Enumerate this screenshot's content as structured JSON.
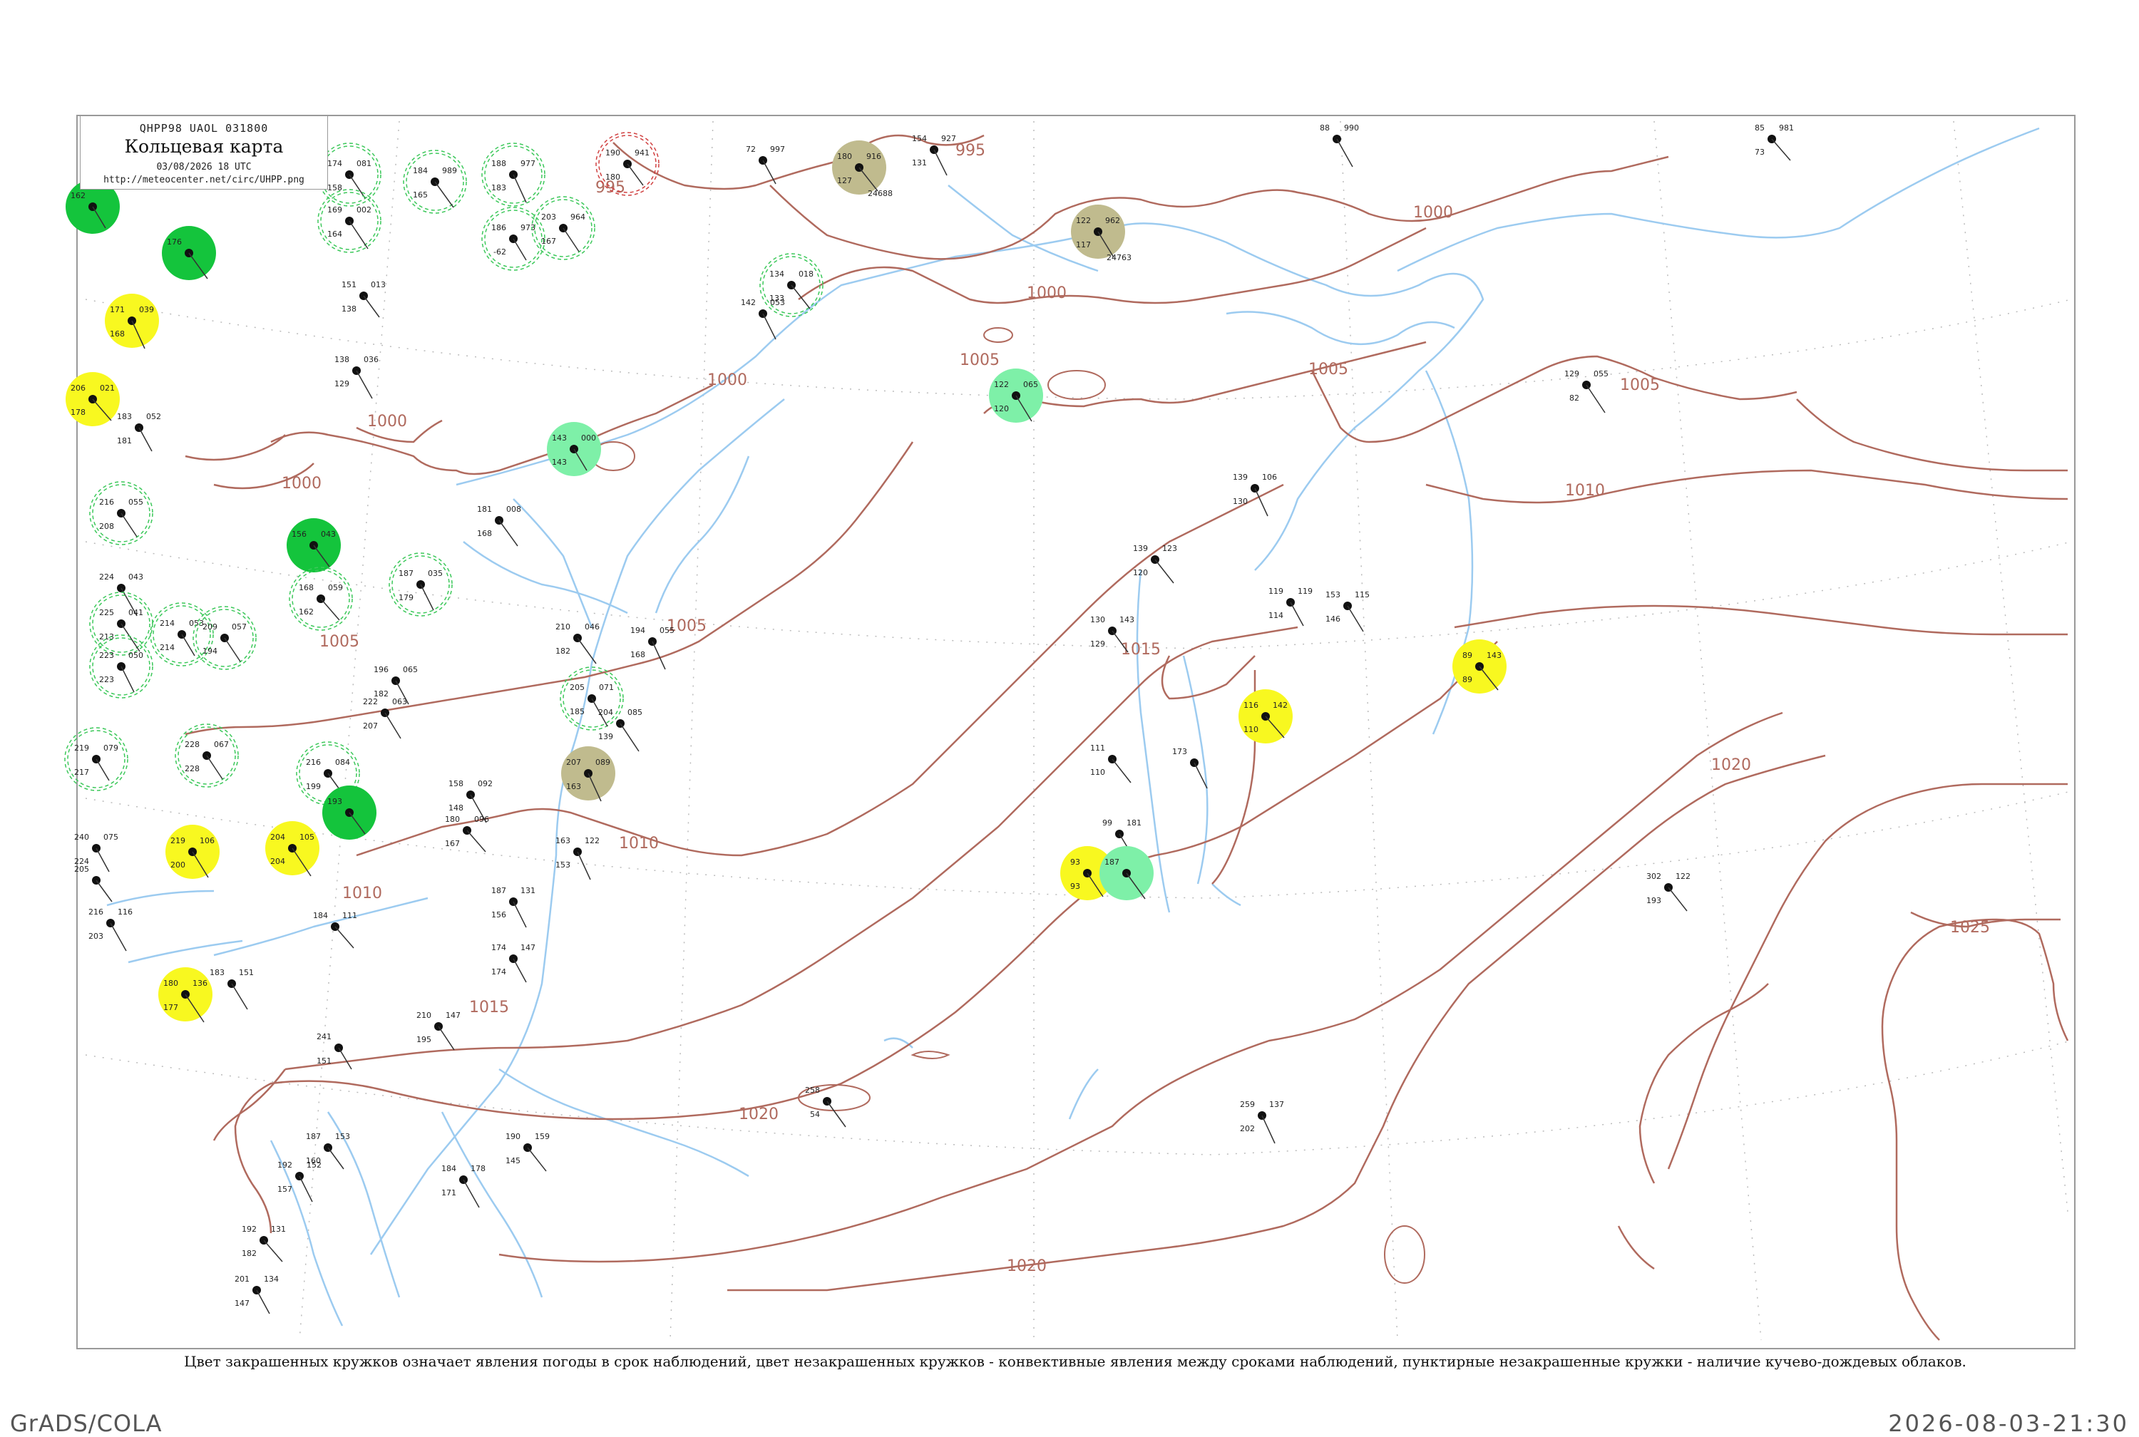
{
  "header": {
    "code": "QHPP98  UAOL  031800",
    "title": "Кольцевая карта",
    "date": "03/08/2026 18 UTC",
    "url": "http://meteocenter.net/circ/UHPP.png"
  },
  "caption": "Цвет закрашенных кружков означает явления погоды в срок наблюдений, цвет незакрашенных кружков - конвективные явления между сроками наблюдений, пунктирные незакрашенные кружки - наличие кучево-дождевых облаков.",
  "footer": {
    "left": "GrADS/COLA",
    "right": "2026-08-03-21:30"
  },
  "colors": {
    "isobar": "#b06a5e",
    "water": "#9ccbf0",
    "rain": "#14c43c",
    "drizzle": "#7ef0a8",
    "fog": "#f8f820",
    "haze": "#c0bb8e",
    "shower_outline": "#3cc85a"
  },
  "isobar_labels": [
    "995",
    "995",
    "1000",
    "1000",
    "1000",
    "1000",
    "1000",
    "1005",
    "1005",
    "1005",
    "1005",
    "1005",
    "1010",
    "1010",
    "1010",
    "1015",
    "1015",
    "1020",
    "1020",
    "1020",
    "1025"
  ],
  "stations": [
    {
      "name": "",
      "id": "",
      "t": "162",
      "p": "",
      "td": "",
      "wx": "rain"
    },
    {
      "name": "",
      "id": "",
      "t": "174",
      "p": "081",
      "td": "158",
      "wx": "shower"
    },
    {
      "name": "",
      "id": "",
      "t": "184",
      "p": "989",
      "td": "165",
      "wx": "shower"
    },
    {
      "name": "",
      "id": "",
      "t": "188",
      "p": "977",
      "td": "183",
      "wx": "shower"
    },
    {
      "name": "",
      "id": "",
      "t": "190",
      "p": "941",
      "td": "180",
      "wx": "thunder"
    },
    {
      "name": "",
      "id": "24688",
      "t": "180",
      "p": "916",
      "td": "127",
      "wx": "haze"
    },
    {
      "name": "",
      "id": "",
      "t": "154",
      "p": "927",
      "td": "131",
      "wx": "none"
    },
    {
      "name": "",
      "id": "",
      "t": "88",
      "p": "990",
      "td": "",
      "wx": "none"
    },
    {
      "name": "",
      "id": "",
      "t": "85",
      "p": "981",
      "td": "73",
      "wx": "none"
    },
    {
      "name": "",
      "id": "",
      "t": "72",
      "p": "997",
      "td": "",
      "wx": "none"
    },
    {
      "name": "",
      "id": "24763",
      "t": "122",
      "p": "962",
      "td": "117",
      "wx": "haze"
    },
    {
      "name": "",
      "id": "",
      "t": "169",
      "p": "002",
      "td": "164",
      "wx": "shower"
    },
    {
      "name": "",
      "id": "",
      "t": "186",
      "p": "973",
      "td": "-62",
      "wx": "shower"
    },
    {
      "name": "",
      "id": "",
      "t": "203",
      "p": "964",
      "td": "167",
      "wx": "shower"
    },
    {
      "name": "",
      "id": "",
      "t": "176",
      "p": "",
      "td": "",
      "wx": "rain"
    },
    {
      "name": "",
      "id": "",
      "t": "171",
      "p": "039",
      "td": "168",
      "wx": "fog"
    },
    {
      "name": "",
      "id": "",
      "t": "151",
      "p": "013",
      "td": "138",
      "wx": "none"
    },
    {
      "name": "",
      "id": "",
      "t": "134",
      "p": "018",
      "td": "133",
      "wx": "shower"
    },
    {
      "name": "",
      "id": "",
      "t": "142",
      "p": "053",
      "td": "",
      "wx": "none"
    },
    {
      "name": "",
      "id": "",
      "t": "138",
      "p": "036",
      "td": "129",
      "wx": "none"
    },
    {
      "name": "",
      "id": "",
      "t": "206",
      "p": "021",
      "td": "178",
      "wx": "fog"
    },
    {
      "name": "",
      "id": "",
      "t": "183",
      "p": "052",
      "td": "181",
      "wx": "none"
    },
    {
      "name": "",
      "id": "",
      "t": "122",
      "p": "065",
      "td": "120",
      "wx": "drizzle"
    },
    {
      "name": "",
      "id": "",
      "t": "129",
      "p": "055",
      "td": "82",
      "wx": "none"
    },
    {
      "name": "",
      "id": "",
      "t": "143",
      "p": "000",
      "td": "143",
      "wx": "drizzle"
    },
    {
      "name": "",
      "id": "",
      "t": "216",
      "p": "055",
      "td": "208",
      "wx": "shower"
    },
    {
      "name": "",
      "id": "",
      "t": "181",
      "p": "008",
      "td": "168",
      "wx": "none"
    },
    {
      "name": "",
      "id": "",
      "t": "139",
      "p": "106",
      "td": "130",
      "wx": "none"
    },
    {
      "name": "",
      "id": "",
      "t": "156",
      "p": "043",
      "td": "",
      "wx": "rain"
    },
    {
      "name": "",
      "id": "",
      "t": "139",
      "p": "123",
      "td": "120",
      "wx": "none"
    },
    {
      "name": "",
      "id": "",
      "t": "187",
      "p": "035",
      "td": "179",
      "wx": "shower"
    },
    {
      "name": "",
      "id": "",
      "t": "224",
      "p": "043",
      "td": "",
      "wx": "none"
    },
    {
      "name": "",
      "id": "",
      "t": "168",
      "p": "059",
      "td": "162",
      "wx": "shower"
    },
    {
      "name": "",
      "id": "",
      "t": "119",
      "p": "119",
      "td": "114",
      "wx": "none"
    },
    {
      "name": "",
      "id": "",
      "t": "153",
      "p": "115",
      "td": "146",
      "wx": "none"
    },
    {
      "name": "",
      "id": "",
      "t": "225",
      "p": "041",
      "td": "213",
      "wx": "shower"
    },
    {
      "name": "",
      "id": "",
      "t": "214",
      "p": "053",
      "td": "214",
      "wx": "shower"
    },
    {
      "name": "",
      "id": "",
      "t": "209",
      "p": "057",
      "td": "194",
      "wx": "shower"
    },
    {
      "name": "",
      "id": "",
      "t": "210",
      "p": "046",
      "td": "182",
      "wx": "none"
    },
    {
      "name": "",
      "id": "",
      "t": "194",
      "p": "055",
      "td": "168",
      "wx": "none"
    },
    {
      "name": "",
      "id": "",
      "t": "130",
      "p": "143",
      "td": "129",
      "wx": "none"
    },
    {
      "name": "",
      "id": "",
      "t": "89",
      "p": "143",
      "td": "89",
      "wx": "fog"
    },
    {
      "name": "",
      "id": "",
      "t": "223",
      "p": "050",
      "td": "223",
      "wx": "shower"
    },
    {
      "name": "",
      "id": "",
      "t": "205",
      "p": "071",
      "td": "185",
      "wx": "shower"
    },
    {
      "name": "",
      "id": "",
      "t": "116",
      "p": "142",
      "td": "110",
      "wx": "fog"
    },
    {
      "name": "",
      "id": "",
      "t": "196",
      "p": "065",
      "td": "182",
      "wx": "none"
    },
    {
      "name": "",
      "id": "",
      "t": "222",
      "p": "063",
      "td": "207",
      "wx": "none"
    },
    {
      "name": "",
      "id": "",
      "t": "204",
      "p": "085",
      "td": "139",
      "wx": "none"
    },
    {
      "name": "",
      "id": "",
      "t": "219",
      "p": "079",
      "td": "217",
      "wx": "shower"
    },
    {
      "name": "",
      "id": "",
      "t": "228",
      "p": "067",
      "td": "228",
      "wx": "shower"
    },
    {
      "name": "",
      "id": "",
      "t": "216",
      "p": "084",
      "td": "199",
      "wx": "shower"
    },
    {
      "name": "",
      "id": "",
      "t": "207",
      "p": "089",
      "td": "163",
      "wx": "haze"
    },
    {
      "name": "",
      "id": "",
      "t": "193",
      "p": "",
      "td": "",
      "wx": "rain"
    },
    {
      "name": "",
      "id": "",
      "t": "111",
      "p": "",
      "td": "110",
      "wx": "none"
    },
    {
      "name": "",
      "id": "",
      "t": "173",
      "p": "",
      "td": "",
      "wx": "none"
    },
    {
      "name": "",
      "id": "",
      "t": "158",
      "p": "092",
      "td": "148",
      "wx": "none"
    },
    {
      "name": "",
      "id": "",
      "t": "180",
      "p": "096",
      "td": "167",
      "wx": "none"
    },
    {
      "name": "",
      "id": "",
      "t": "240",
      "p": "075",
      "td": "224",
      "wx": "none"
    },
    {
      "name": "",
      "id": "",
      "t": "219",
      "p": "106",
      "td": "200",
      "wx": "fog"
    },
    {
      "name": "",
      "id": "",
      "t": "204",
      "p": "105",
      "td": "204",
      "wx": "fog"
    },
    {
      "name": "",
      "id": "",
      "t": "99",
      "p": "181",
      "td": "",
      "wx": "none"
    },
    {
      "name": "",
      "id": "",
      "t": "93",
      "p": "",
      "td": "93",
      "wx": "fog"
    },
    {
      "name": "",
      "id": "",
      "t": "187",
      "p": "",
      "td": "",
      "wx": "drizzle"
    },
    {
      "name": "",
      "id": "",
      "t": "163",
      "p": "122",
      "td": "153",
      "wx": "none"
    },
    {
      "name": "",
      "id": "",
      "t": "205",
      "p": "",
      "td": "",
      "wx": "none"
    },
    {
      "name": "",
      "id": "",
      "t": "302",
      "p": "122",
      "td": "193",
      "wx": "none"
    },
    {
      "name": "",
      "id": "",
      "t": "187",
      "p": "131",
      "td": "156",
      "wx": "none"
    },
    {
      "name": "",
      "id": "",
      "t": "216",
      "p": "116",
      "td": "203",
      "wx": "none"
    },
    {
      "name": "",
      "id": "",
      "t": "184",
      "p": "111",
      "td": "",
      "wx": "none"
    },
    {
      "name": "",
      "id": "",
      "t": "174",
      "p": "147",
      "td": "174",
      "wx": "none"
    },
    {
      "name": "",
      "id": "",
      "t": "183",
      "p": "151",
      "td": "",
      "wx": "none"
    },
    {
      "name": "",
      "id": "",
      "t": "180",
      "p": "136",
      "td": "177",
      "wx": "fog"
    },
    {
      "name": "",
      "id": "",
      "t": "241",
      "p": "",
      "td": "151",
      "wx": "none"
    },
    {
      "name": "",
      "id": "",
      "t": "210",
      "p": "147",
      "td": "195",
      "wx": "none"
    },
    {
      "name": "",
      "id": "",
      "t": "258",
      "p": "",
      "td": "54",
      "wx": "none"
    },
    {
      "name": "",
      "id": "",
      "t": "259",
      "p": "137",
      "td": "202",
      "wx": "none"
    },
    {
      "name": "",
      "id": "",
      "t": "187",
      "p": "153",
      "td": "160",
      "wx": "none"
    },
    {
      "name": "",
      "id": "",
      "t": "190",
      "p": "159",
      "td": "145",
      "wx": "none"
    },
    {
      "name": "",
      "id": "",
      "t": "192",
      "p": "152",
      "td": "157",
      "wx": "none"
    },
    {
      "name": "",
      "id": "",
      "t": "184",
      "p": "178",
      "td": "171",
      "wx": "none"
    },
    {
      "name": "",
      "id": "",
      "t": "192",
      "p": "131",
      "td": "182",
      "wx": "none"
    },
    {
      "name": "",
      "id": "",
      "t": "201",
      "p": "134",
      "td": "147",
      "wx": "none"
    }
  ]
}
